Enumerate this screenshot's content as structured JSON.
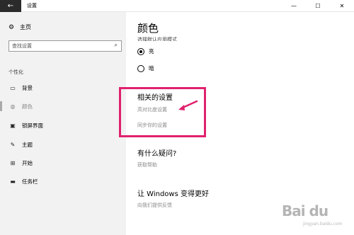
{
  "titlebar": {
    "back_glyph": "←",
    "title": "设置",
    "minimize_glyph": "—",
    "maximize_glyph": "☐",
    "close_glyph": "✕"
  },
  "sidebar": {
    "home": {
      "icon": "gear-icon",
      "label": "主页"
    },
    "search": {
      "placeholder": "查找设置",
      "icon": "search-icon"
    },
    "section_label": "个性化",
    "items": [
      {
        "label": "背景",
        "icon": "picture-icon",
        "selected": false
      },
      {
        "label": "颜色",
        "icon": "palette-icon",
        "selected": true
      },
      {
        "label": "锁屏界面",
        "icon": "monitor-icon",
        "selected": false
      },
      {
        "label": "主题",
        "icon": "brush-icon",
        "selected": false
      },
      {
        "label": "开始",
        "icon": "start-grid-icon",
        "selected": false
      },
      {
        "label": "任务栏",
        "icon": "taskbar-icon",
        "selected": false
      }
    ]
  },
  "main": {
    "title": "颜色",
    "cut_text": "选择默认应用模式",
    "radio_options": [
      {
        "label": "亮",
        "checked": true
      },
      {
        "label": "暗",
        "checked": false
      }
    ],
    "related": {
      "title": "相关的设置",
      "links": [
        "高对比度设置",
        "同步你的设置"
      ]
    },
    "question": {
      "title": "有什么疑问?",
      "link": "获取帮助"
    },
    "feedback": {
      "title": "让 Windows 变得更好",
      "link": "向我们提供反馈"
    }
  },
  "colors": {
    "highlight_box": "#e0216e",
    "accent_arrow": "#e0216e",
    "sidebar_bg": "#f2f2f2"
  },
  "watermark": {
    "logo": "Bai du",
    "sub": "jingyan.baidu.com"
  }
}
